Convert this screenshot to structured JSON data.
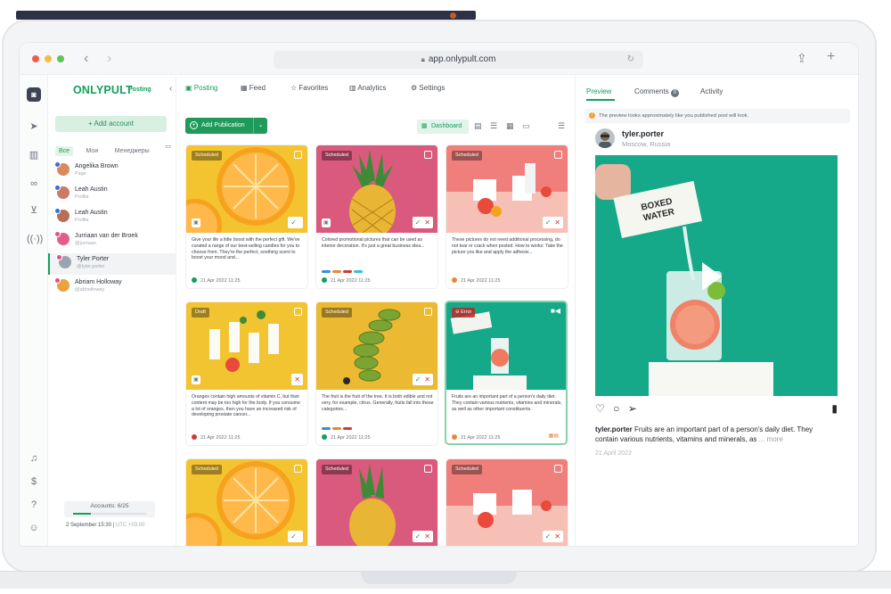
{
  "browser": {
    "url": "app.onlypult.com"
  },
  "sidebar": {
    "brand": "ONLYPULT",
    "brand_sub": "Posting",
    "add_account": "Add account",
    "filters": [
      "Все",
      "Мои",
      "Менеджеры"
    ],
    "accounts": [
      {
        "name": "Angelika Brown",
        "sub": "Page"
      },
      {
        "name": "Leah Austin",
        "sub": "Profile"
      },
      {
        "name": "Leah Austin",
        "sub": "Profile"
      },
      {
        "name": "Jurriaan van der Broek",
        "sub": "@jurriaan"
      },
      {
        "name": "Tyler Porter",
        "sub": "@tyler.porter"
      },
      {
        "name": "Abriam Holloway",
        "sub": "@abholloway"
      }
    ],
    "accounts_count": "Accounts: 6/25",
    "date": "2 September 15:30",
    "timezone": "UTC +03:00"
  },
  "main": {
    "tabs": [
      "Posting",
      "Feed",
      "Favorites",
      "Analytics",
      "Settings"
    ],
    "add_publication": "Add Publication",
    "view_dashboard": "Dashboard",
    "cards": [
      {
        "status": "Scheduled",
        "text": "Give your life a little boost with the perfect gift. We've curated a range of our best-selling candles for you to choose from. They're the perfect, soothing scent to boost your mood and...",
        "date": "21 Apr 2022  11:25"
      },
      {
        "status": "Scheduled",
        "text": "Colored promotional pictures that can be used as interior decoration. It's just a great business idea...",
        "date": "21 Apr 2022  11:25"
      },
      {
        "status": "Scheduled",
        "text": "These pictures do not need additional processing, do not tear or crack when posted. How to works: Take the picture you like and apply the adhesiv...",
        "date": "21 Apr 2022  11:25"
      },
      {
        "status": "Draft",
        "text": "Oranges contain high amounts of vitamin C, but their content may be too high for the body. If you consume a lot of oranges, then you have an increased risk of developing prostate cancer...",
        "date": "21 Apr 2022  11:25"
      },
      {
        "status": "Scheduled",
        "text": "The fruit is the fruit of the tree. It is both edible and not very, for example, citrus. Generally, fruits fall into these categories...",
        "date": "21 Apr 2022  11:25"
      },
      {
        "status": "Error",
        "text": "Fruits are an important part of a person's daily diet. They contain various nutrients, vitamins and minerals, as well as other important constituents.",
        "date": "21 Apr 2022  11:25"
      },
      {
        "status": "Scheduled"
      },
      {
        "status": "Scheduled"
      },
      {
        "status": "Scheduled"
      }
    ]
  },
  "preview": {
    "tabs": [
      "Preview",
      "Comments",
      "Activity"
    ],
    "comments_count": "0",
    "notice": "The preview looks approximately like you published post will look.",
    "username": "tyler.porter",
    "location": "Moscow, Russia",
    "caption_user": "tyler.porter",
    "caption": "Fruits are an important part of a person's daily diet. They contain various nutrients, vitamins and minerals, as",
    "more": "... more",
    "date": "21 April 2022"
  }
}
